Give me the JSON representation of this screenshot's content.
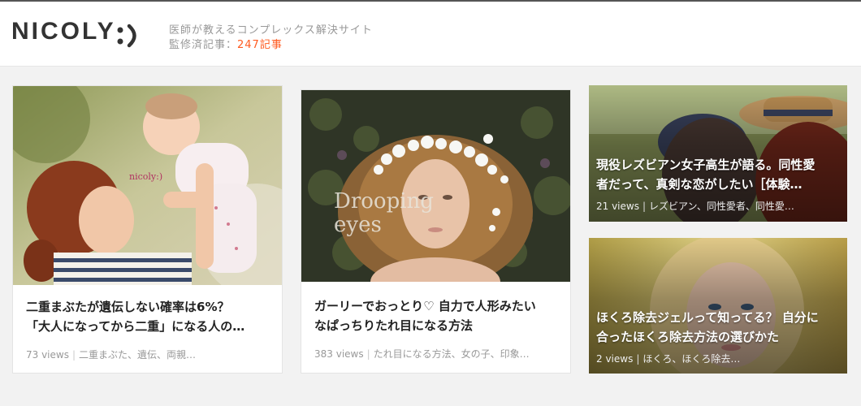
{
  "site": {
    "logo": "NICOLY",
    "tagline": "医師が教えるコンプレックス解決サイト",
    "articles_label": "監修済記事：",
    "articles_count": "247記事"
  },
  "cards": [
    {
      "title_line1": "二重まぶたが遺伝しない確率は6%？",
      "title_line2": "「大人になってから二重」になる人の…",
      "views": "73 views",
      "tags": "二重まぶた、遺伝、両親…",
      "image_caption": "nicoly:)"
    },
    {
      "title_line1": "ガーリーでおっとり♡ 自力で人形みたい",
      "title_line2": "なぱっちりたれ目になる方法",
      "views": "383 views",
      "tags": "たれ目になる方法、女の子、印象…",
      "image_caption_line1": "Drooping",
      "image_caption_line2": "eyes"
    },
    {
      "title_line1": "現役レズビアン女子高生が語る。同性愛",
      "title_line2": "者だって、真剣な恋がしたい［体験…",
      "views": "21 views",
      "tags": "レズビアン、同性愛者、同性愛…"
    },
    {
      "title_line1": "ほくろ除去ジェルって知ってる？ 自分に",
      "title_line2": "合ったほくろ除去方法の選びかた",
      "views": "2 views",
      "tags": "ほくろ、ほくろ除去…"
    }
  ]
}
